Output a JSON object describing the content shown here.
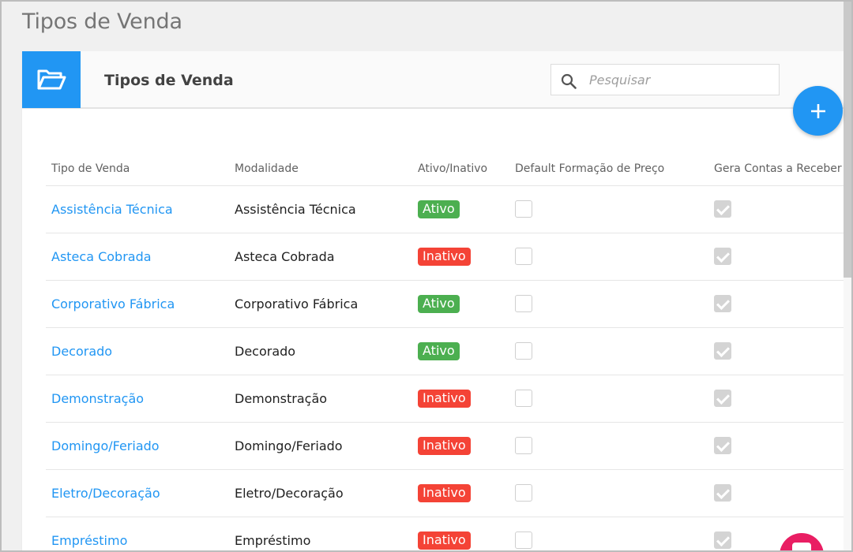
{
  "page": {
    "title": "Tipos de Venda"
  },
  "card": {
    "title": "Tipos de Venda",
    "icon": "folder-open-icon",
    "search_placeholder": "Pesquisar",
    "search_icon": "search-icon",
    "add_icon": "plus-icon"
  },
  "table": {
    "headers": [
      "Tipo de Venda",
      "Modalidade",
      "Ativo/Inativo",
      "Default Formação de Preço",
      "Gera Contas a Receber"
    ],
    "rows": [
      {
        "tipo": "Assistência Técnica",
        "modalidade": "Assistência Técnica",
        "status": "Ativo",
        "active": true,
        "default_preco": false,
        "gera_contas": true
      },
      {
        "tipo": "Asteca Cobrada",
        "modalidade": "Asteca Cobrada",
        "status": "Inativo",
        "active": false,
        "default_preco": false,
        "gera_contas": true
      },
      {
        "tipo": "Corporativo Fábrica",
        "modalidade": "Corporativo Fábrica",
        "status": "Ativo",
        "active": true,
        "default_preco": false,
        "gera_contas": true
      },
      {
        "tipo": "Decorado",
        "modalidade": "Decorado",
        "status": "Ativo",
        "active": true,
        "default_preco": false,
        "gera_contas": true
      },
      {
        "tipo": "Demonstração",
        "modalidade": "Demonstração",
        "status": "Inativo",
        "active": false,
        "default_preco": false,
        "gera_contas": true
      },
      {
        "tipo": "Domingo/Feriado",
        "modalidade": "Domingo/Feriado",
        "status": "Inativo",
        "active": false,
        "default_preco": false,
        "gera_contas": true
      },
      {
        "tipo": "Eletro/Decoração",
        "modalidade": "Eletro/Decoração",
        "status": "Inativo",
        "active": false,
        "default_preco": false,
        "gera_contas": true
      },
      {
        "tipo": "Empréstimo",
        "modalidade": "Empréstimo",
        "status": "Inativo",
        "active": false,
        "default_preco": false,
        "gera_contas": true
      }
    ]
  },
  "colors": {
    "accent": "#2196f3",
    "active_badge": "#4caf50",
    "inactive_badge": "#f44336",
    "chat_button": "#e91e63"
  }
}
